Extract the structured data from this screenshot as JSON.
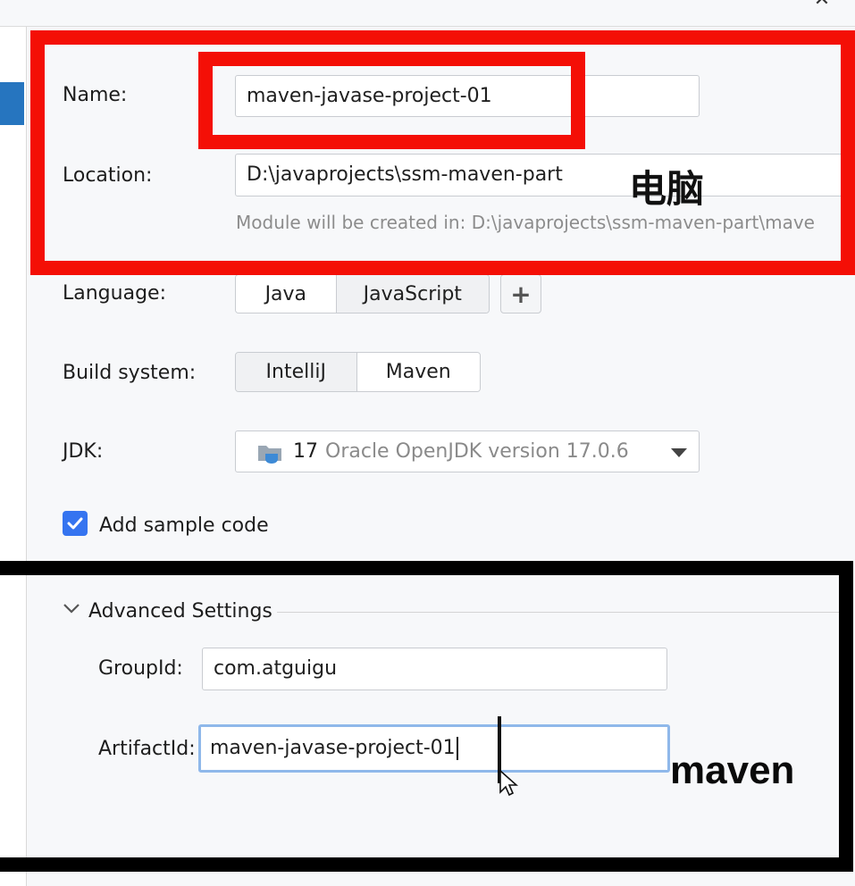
{
  "form": {
    "name_label": "Name:",
    "name_value": "maven-javase-project-01",
    "location_label": "Location:",
    "location_value": "D:\\javaprojects\\ssm-maven-part",
    "location_hint": "Module will be created in: D:\\javaprojects\\ssm-maven-part\\mave",
    "language_label": "Language:",
    "language_options": [
      "Java",
      "JavaScript"
    ],
    "language_selected": "Java",
    "add_language_label": "+",
    "build_system_label": "Build system:",
    "build_options": [
      "IntelliJ",
      "Maven"
    ],
    "build_selected": "Maven",
    "jdk_label": "JDK:",
    "jdk_version_num": "17",
    "jdk_version_text": "Oracle OpenJDK version 17.0.6",
    "sample_code_label": "Add sample code",
    "sample_code_checked": true
  },
  "advanced": {
    "title": "Advanced Settings",
    "expanded": true,
    "group_id_label": "GroupId:",
    "group_id_value": "com.atguigu",
    "artifact_id_label": "ArtifactId:",
    "artifact_id_value": "maven-javase-project-01"
  },
  "annotations": {
    "red_text": "电脑",
    "black_text": "maven",
    "red_color": "#f40f06",
    "black_color": "#000000"
  },
  "colors": {
    "accent": "#3574f0",
    "sidebar_selected": "#2675bf",
    "focus_border": "#8fb8ea"
  }
}
